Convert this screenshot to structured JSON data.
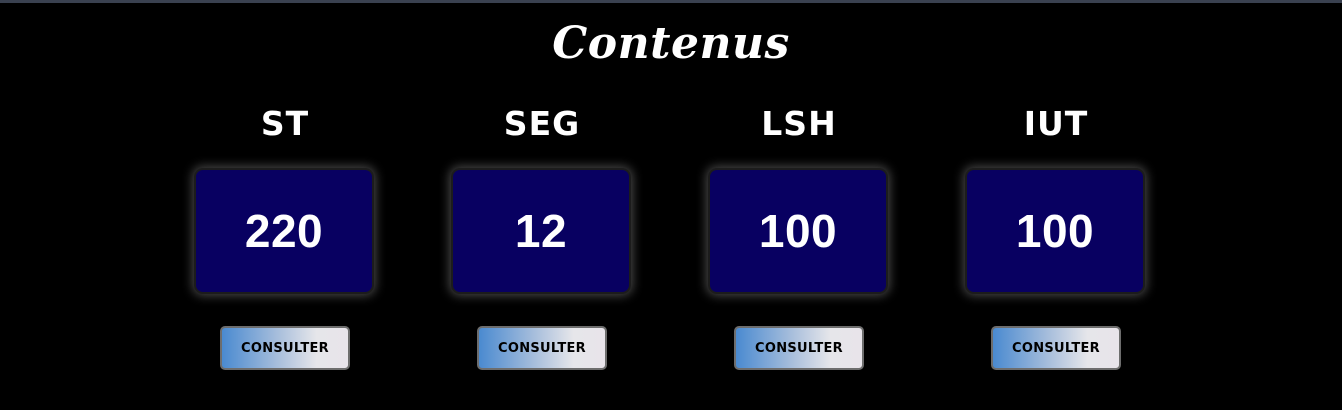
{
  "page": {
    "title": "Contenus"
  },
  "cards": [
    {
      "title": "ST",
      "count": "220",
      "button_label": "CONSULTER"
    },
    {
      "title": "SEG",
      "count": "12",
      "button_label": "CONSULTER"
    },
    {
      "title": "LSH",
      "count": "100",
      "button_label": "CONSULTER"
    },
    {
      "title": "IUT",
      "count": "100",
      "button_label": "CONSULTER"
    }
  ],
  "colors": {
    "background": "#000000",
    "count_box": "#080061",
    "button_gradient_start": "#4a8ad0",
    "button_gradient_end": "#e8e4ea"
  }
}
